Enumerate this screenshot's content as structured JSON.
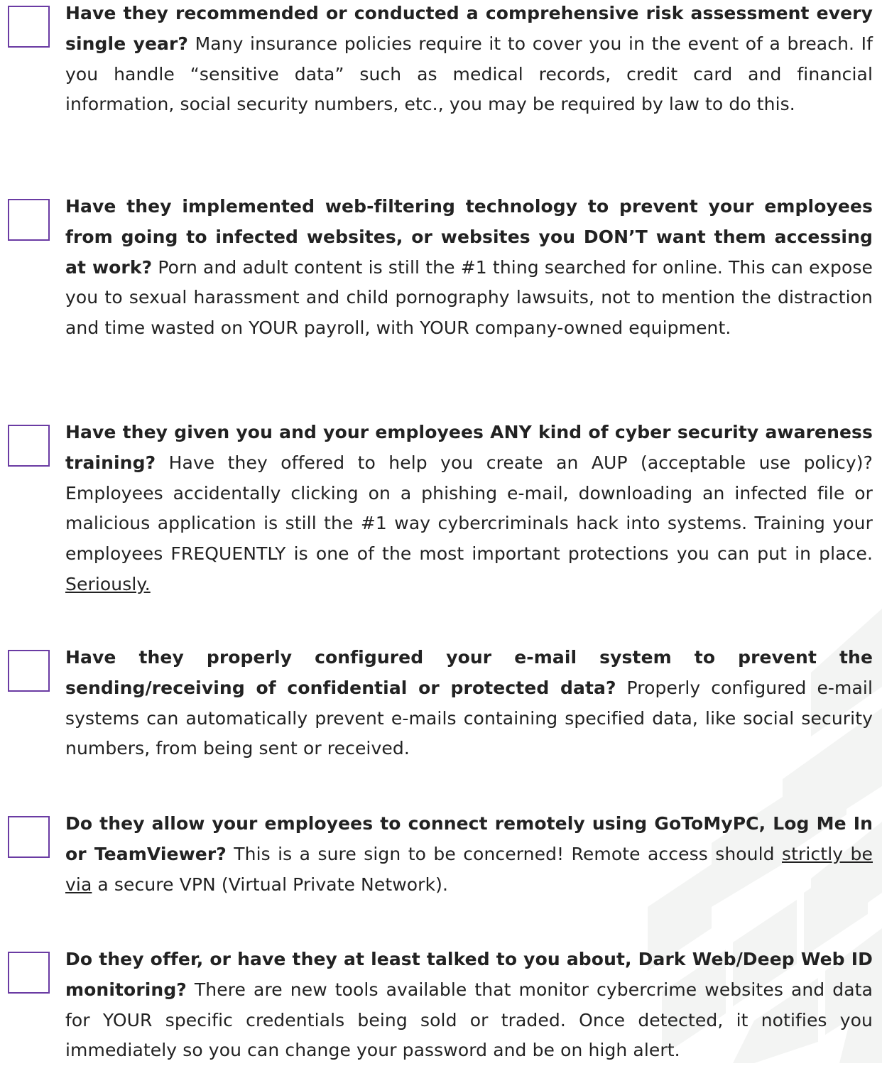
{
  "colors": {
    "checkbox_border": "#6a3ba3",
    "text": "#222222",
    "watermark": "#f3f4f3"
  },
  "items": [
    {
      "question": "Have they recommended or conducted a comprehensive risk assessment every single year?",
      "body": " Many insurance policies require it to cover you in the event of a breach. If you handle “sensitive data” such as medical records, credit card and financial information, social security numbers, etc., you may be required by law to do this."
    },
    {
      "question": "Have they implemented web-filtering technology to prevent your employees from going to infected websites, or websites you DON’T want them accessing at work?",
      "body": " Porn and adult content is still the #1 thing searched for online. This can expose you to sexual harassment and child pornography lawsuits, not to mention the distraction and time wasted on YOUR payroll, with YOUR company-owned equipment."
    },
    {
      "question": "Have they given you and your employees ANY kind of cyber security awareness training?",
      "body": " Have they offered to help you create an AUP (acceptable use policy)? Employees accidentally clicking on a phishing e-mail, downloading an infected file or malicious application is still the #1 way cybercriminals hack into systems. Training your employees FREQUENTLY is one of the most important protections you can put in place. ",
      "underlined": "Seriously."
    },
    {
      "question": "Have they properly configured your e-mail system to prevent the sending/receiving of confidential or protected data?",
      "body": " Properly configured e-mail systems can automatically prevent e-mails containing specified data, like social security numbers, from being sent or received."
    },
    {
      "question": "Do they allow your employees to connect remotely using GoToMyPC, Log Me In or TeamViewer?",
      "body_before": " This is a sure sign to be concerned! Remote access should ",
      "underlined": "strictly be via",
      "body_after": " a secure VPN (Virtual Private Network)."
    },
    {
      "question": "Do they offer, or have they at least talked to you about, Dark Web/Deep Web ID monitoring?",
      "body": " There are new tools available that monitor cybercrime websites and data for YOUR specific credentials being sold or traded. Once detected, it notifies you immediately so you can change your password and be on high alert."
    }
  ]
}
